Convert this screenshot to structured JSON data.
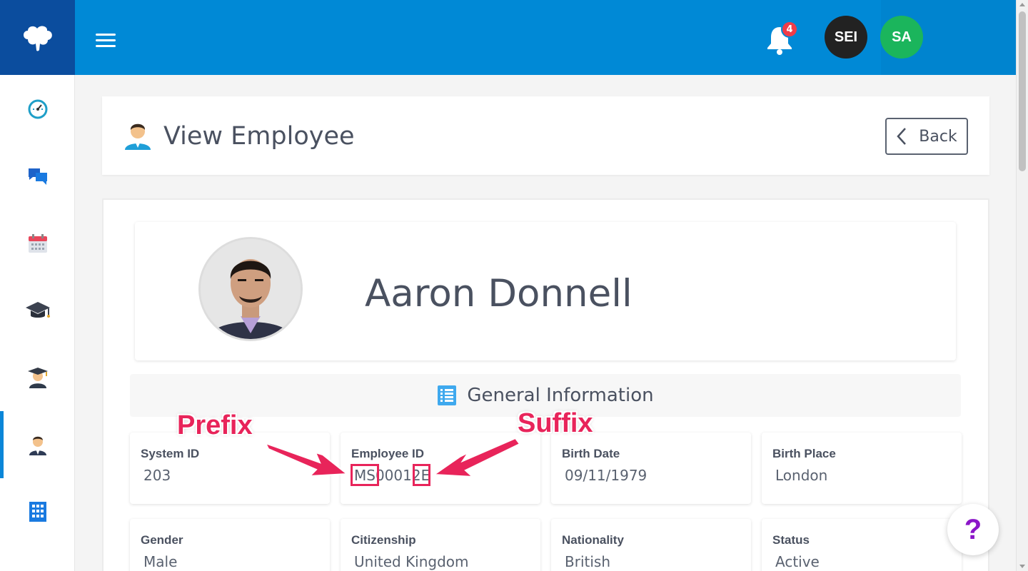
{
  "header": {
    "notification_count": "4",
    "user_avatars": [
      {
        "initials": "SEI",
        "color": "#222222"
      },
      {
        "initials": "SA",
        "color": "#1bb55c"
      }
    ]
  },
  "sidebar": {
    "items": [
      {
        "icon": "dashboard-gauge-icon"
      },
      {
        "icon": "chat-bubbles-icon"
      },
      {
        "icon": "calendar-icon"
      },
      {
        "icon": "graduation-cap-icon"
      },
      {
        "icon": "student-icon"
      },
      {
        "icon": "employee-icon",
        "active": true
      },
      {
        "icon": "building-icon"
      }
    ]
  },
  "page": {
    "title": "View Employee",
    "back_label": "Back"
  },
  "profile": {
    "name": "Aaron Donnell"
  },
  "section": {
    "title": "General Information"
  },
  "fields": [
    {
      "label": "System ID",
      "value": "203"
    },
    {
      "label": "Employee ID",
      "value": "MS00012E"
    },
    {
      "label": "Birth Date",
      "value": "09/11/1979"
    },
    {
      "label": "Birth Place",
      "value": "London"
    },
    {
      "label": "Gender",
      "value": "Male"
    },
    {
      "label": "Citizenship",
      "value": "United Kingdom"
    },
    {
      "label": "Nationality",
      "value": "British"
    },
    {
      "label": "Status",
      "value": "Active"
    }
  ],
  "annotations": {
    "prefix_label": "Prefix",
    "suffix_label": "Suffix"
  },
  "help": {
    "label": "?"
  },
  "colors": {
    "topbar": "#0089d6",
    "logo_bg": "#0b4d9e",
    "accent": "#0a86d8",
    "annotation": "#e8245a",
    "help": "#8b16c8"
  }
}
